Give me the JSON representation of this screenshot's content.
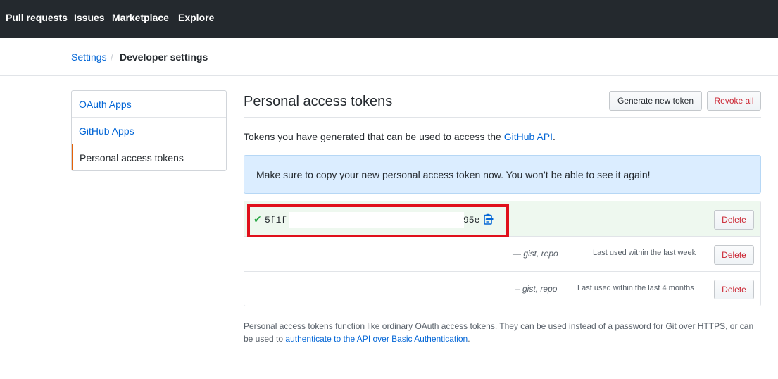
{
  "topnav": {
    "items": [
      {
        "label": "Pull requests"
      },
      {
        "label": "Issues"
      },
      {
        "label": "Marketplace"
      },
      {
        "label": "Explore"
      }
    ]
  },
  "breadcrumb": {
    "parent": "Settings",
    "separator": "/",
    "current": "Developer settings"
  },
  "sidebar": {
    "items": [
      {
        "label": "OAuth Apps"
      },
      {
        "label": "GitHub Apps"
      },
      {
        "label": "Personal access tokens"
      }
    ]
  },
  "main": {
    "title": "Personal access tokens",
    "generate_button": "Generate new token",
    "revoke_button": "Revoke all",
    "intro_text": "Tokens you have generated that can be used to access the ",
    "intro_link": "GitHub API",
    "intro_end": ".",
    "flash_message": "Make sure to copy your new personal access token now. You won’t be able to see it again!"
  },
  "tokens": {
    "new_token": {
      "start": "5f1f",
      "end": "95e",
      "delete_label": "Delete"
    },
    "rows": [
      {
        "scopes": "— gist, repo",
        "last_used": "Last used within the last week",
        "delete_label": "Delete"
      },
      {
        "scopes": "– gist, repo",
        "last_used": "Last used within the last 4 months",
        "delete_label": "Delete"
      }
    ]
  },
  "footer_note": {
    "text_1": "Personal access tokens function like ordinary OAuth access tokens. They can be used instead of a password for Git over HTTPS, or can be used to ",
    "link": "authenticate to the API over Basic Authentication",
    "text_2": "."
  },
  "colors": {
    "header_bg": "#24292e",
    "link": "#0366d6",
    "danger": "#cb2431",
    "flash_bg": "#dbedff",
    "new_token_bg": "#eef8ef",
    "highlight_border": "#e0101b",
    "check": "#28a745"
  },
  "icons": [
    "check-icon",
    "clipboard-icon"
  ]
}
